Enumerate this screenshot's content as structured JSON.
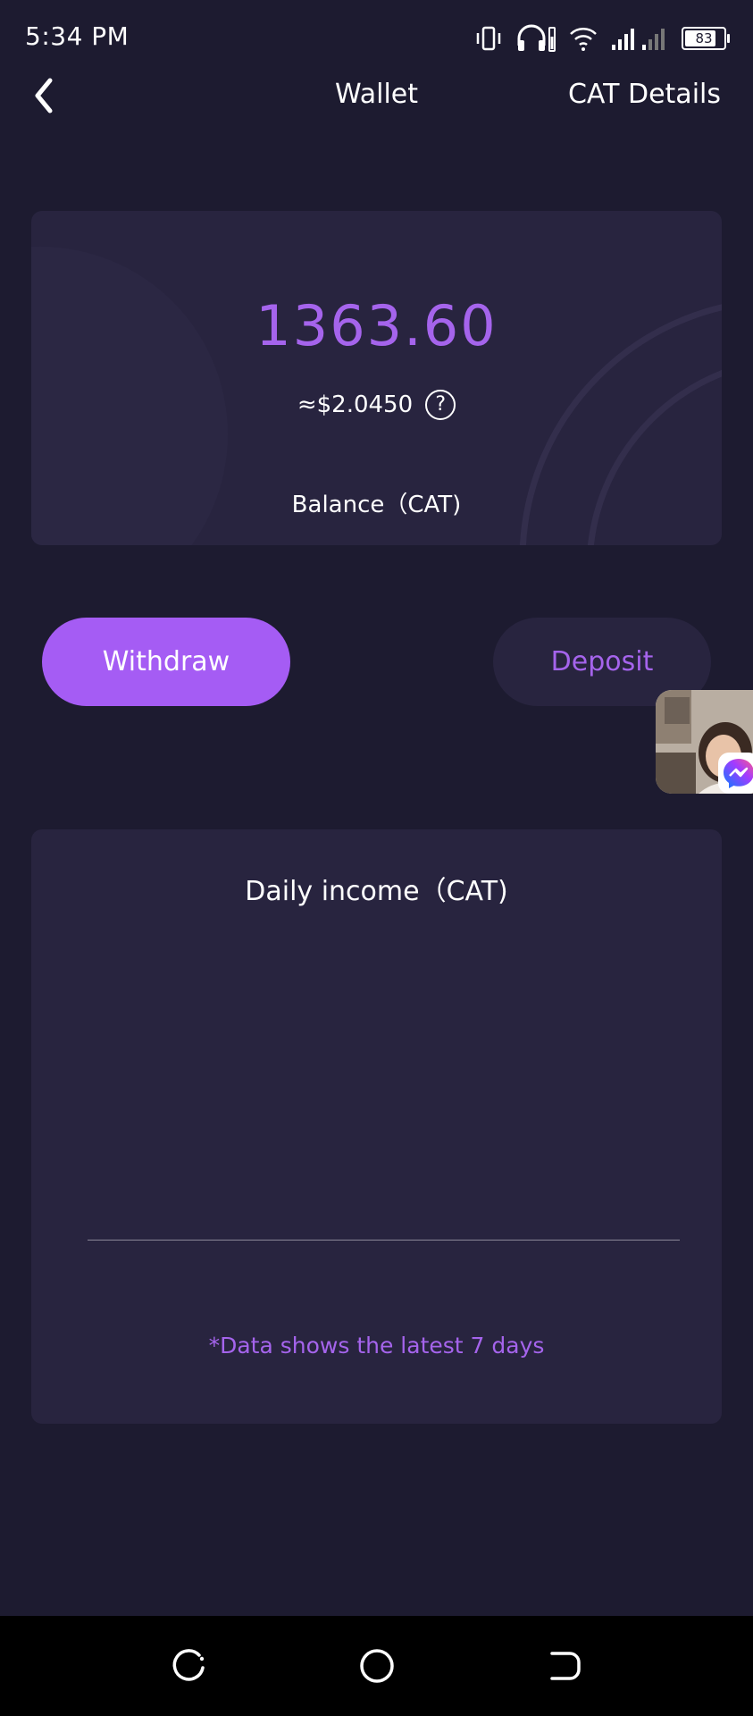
{
  "status_bar": {
    "time": "5:34 PM",
    "battery_level": "83",
    "battery_fraction": 0.83,
    "icons": [
      "vibrate-icon",
      "headphones-icon",
      "wifi-icon",
      "signal-icon",
      "battery-icon"
    ]
  },
  "header": {
    "back_icon": "chevron-left-icon",
    "title": "Wallet",
    "right_link": "CAT Details"
  },
  "balance": {
    "amount": "1363.60",
    "fiat_value": "≈$2.0450",
    "help_icon": "?",
    "label": "Balance（CAT)"
  },
  "actions": {
    "withdraw_label": "Withdraw",
    "deposit_label": "Deposit"
  },
  "chat_head": {
    "badge_icon": "messenger-icon"
  },
  "income": {
    "title": "Daily income（CAT)",
    "note": "*Data shows the latest 7 days"
  },
  "navbar": {
    "buttons": [
      "recents-icon",
      "home-icon",
      "back-icon"
    ]
  },
  "colors": {
    "background": "#1d1b30",
    "card": "#28243f",
    "accent": "#a55cf4",
    "accent_text": "#a564ec"
  }
}
